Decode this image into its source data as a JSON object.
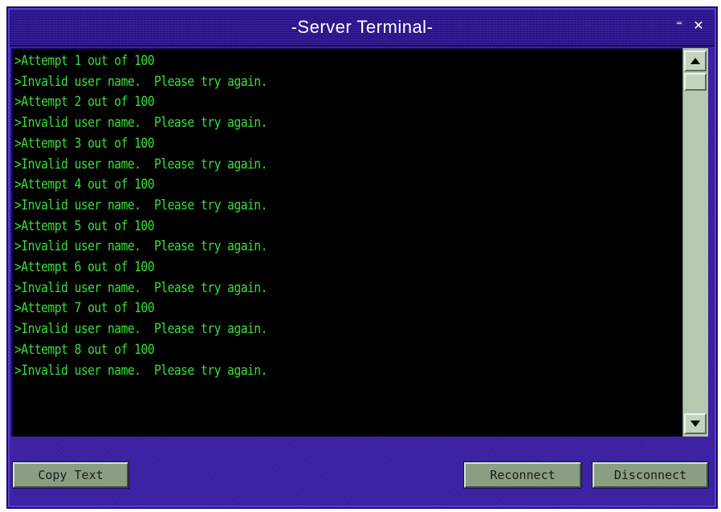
{
  "window": {
    "title": "-Server Terminal-",
    "minimize_glyph": "⁼",
    "close_glyph": "✕"
  },
  "terminal": {
    "lines": [
      ">Attempt 1 out of 100",
      ">Invalid user name.  Please try again.",
      ">Attempt 2 out of 100",
      ">Invalid user name.  Please try again.",
      ">Attempt 3 out of 100",
      ">Invalid user name.  Please try again.",
      ">Attempt 4 out of 100",
      ">Invalid user name.  Please try again.",
      ">Attempt 5 out of 100",
      ">Invalid user name.  Please try again.",
      ">Attempt 6 out of 100",
      ">Invalid user name.  Please try again.",
      ">Attempt 7 out of 100",
      ">Invalid user name.  Please try again.",
      ">Attempt 8 out of 100",
      ">Invalid user name.  Please try again."
    ],
    "text_color": "#38e038"
  },
  "footer": {
    "copy_label": "Copy Text",
    "reconnect_label": "Reconnect",
    "disconnect_label": "Disconnect"
  },
  "colors": {
    "window_bg": "#3a1fa6",
    "terminal_bg": "#000000",
    "button_bg": "#8a9e84"
  }
}
